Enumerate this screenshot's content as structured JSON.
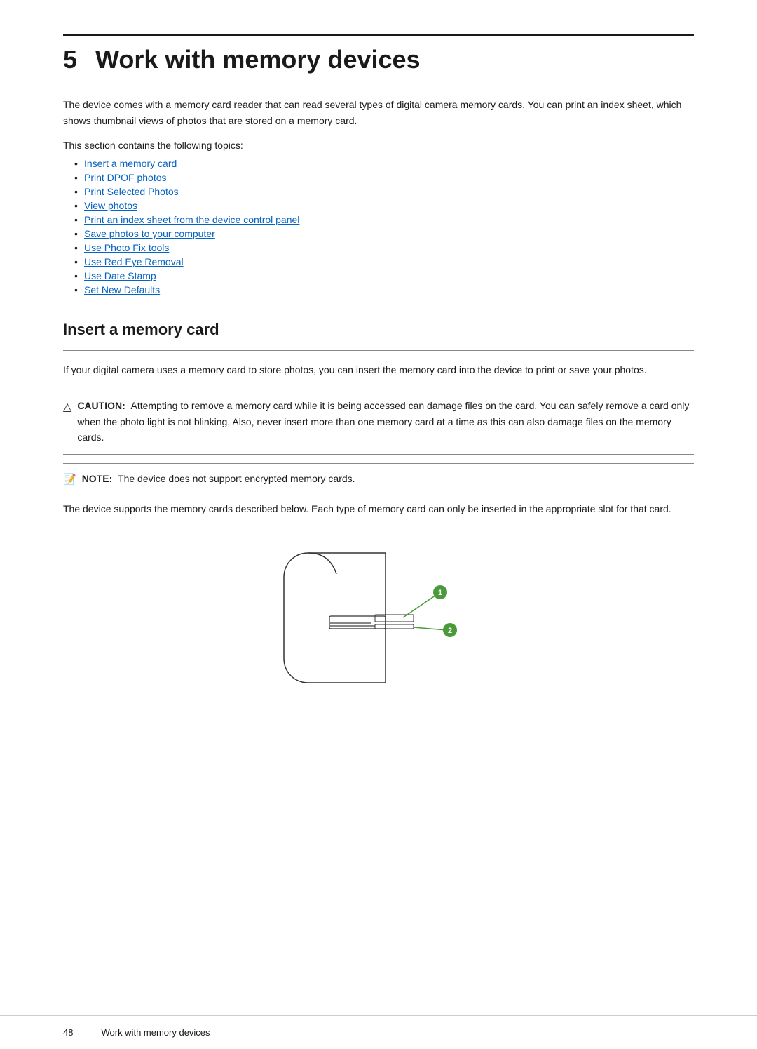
{
  "chapter": {
    "number": "5",
    "title": "Work with memory devices",
    "intro": "The device comes with a memory card reader that can read several types of digital camera memory cards. You can print an index sheet, which shows thumbnail views of photos that are stored on a memory card.",
    "topics_label": "This section contains the following topics:",
    "topics": [
      "Insert a memory card",
      "Print DPOF photos",
      "Print Selected Photos",
      "View photos",
      "Print an index sheet from the device control panel",
      "Save photos to your computer",
      "Use Photo Fix tools",
      "Use Red Eye Removal",
      "Use Date Stamp",
      "Set New Defaults"
    ]
  },
  "section": {
    "title": "Insert a memory card",
    "intro": "If your digital camera uses a memory card to store photos, you can insert the memory card into the device to print or save your photos.",
    "caution_label": "CAUTION:",
    "caution_text": "Attempting to remove a memory card while it is being accessed can damage files on the card. You can safely remove a card only when the photo light is not blinking. Also, never insert more than one memory card at a time as this can also damage files on the memory cards.",
    "note_label": "NOTE:",
    "note_text": "The device does not support encrypted memory cards.",
    "body_text": "The device supports the memory cards described below. Each type of memory card can only be inserted in the appropriate slot for that card."
  },
  "footer": {
    "page_number": "48",
    "chapter_label": "Work with memory devices"
  }
}
